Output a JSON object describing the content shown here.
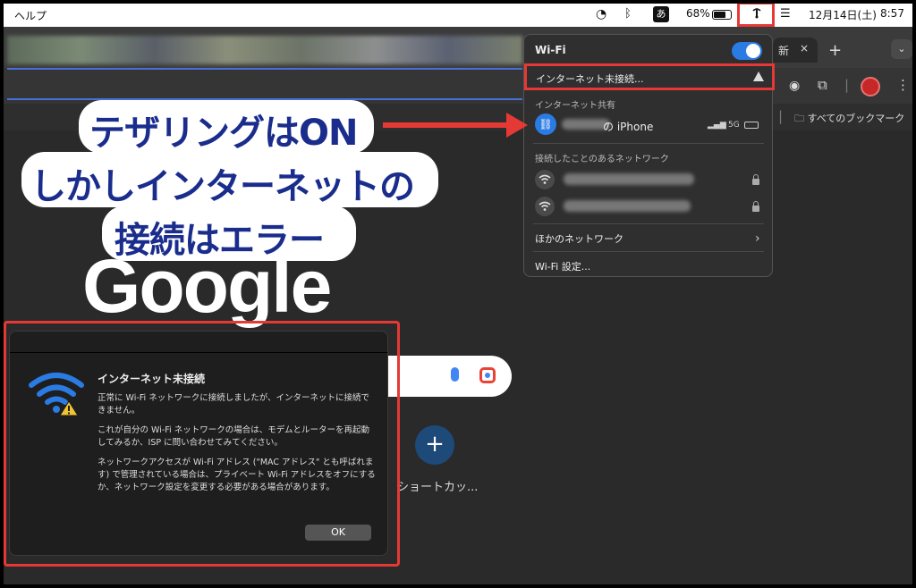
{
  "menubar": {
    "help": "ヘルプ",
    "ime": "あ",
    "battery_pct": "68%",
    "date": "12月14日(土)",
    "time": "8:57"
  },
  "browser": {
    "tab_label": "新",
    "tab_close": "×",
    "new_tab": "+",
    "bookmarks_label": "すべてのブックマーク",
    "google_logo": "Google",
    "add_shortcut": "+",
    "shortcut_label": "ショートカッ..."
  },
  "wifi_menu": {
    "title": "Wi-Fi",
    "status": "インターネット未接続...",
    "section_hotspot": "インターネット共有",
    "hotspot_name": "の iPhone",
    "hotspot_signal": "5G",
    "section_known": "接続したことのあるネットワーク",
    "other_networks": "ほかのネットワーク",
    "settings": "Wi-Fi 設定..."
  },
  "annotation": {
    "line1": "テザリングはON",
    "line2": "しかしインターネットの",
    "line3": "接続はエラー"
  },
  "dialog": {
    "title": "インターネット未接続",
    "p1": "正常に Wi-Fi ネットワークに接続しましたが、インターネットに接続できません。",
    "p2": "これが自分の Wi-Fi ネットワークの場合は、モデムとルーターを再起動してみるか、ISP に問い合わせてみてください。",
    "p3": "ネットワークアクセスが Wi-Fi アドレス (\"MAC アドレス\" とも呼ばれます) で管理されている場合は、プライベート Wi-Fi アドレスをオフにするか、ネットワーク設定を変更する必要がある場合があります。",
    "ok": "OK"
  },
  "colors": {
    "highlight": "#e53935",
    "annotation_text": "#1a2d8c",
    "toggle": "#2a7be4"
  },
  "icons": [
    "wifi-icon",
    "bluetooth-icon",
    "battery-icon",
    "control-center-icon",
    "hotspot-icon",
    "warning-icon",
    "lock-icon",
    "chevron-right-icon",
    "extensions-icon",
    "folder-icon",
    "mic-icon",
    "lens-icon"
  ]
}
